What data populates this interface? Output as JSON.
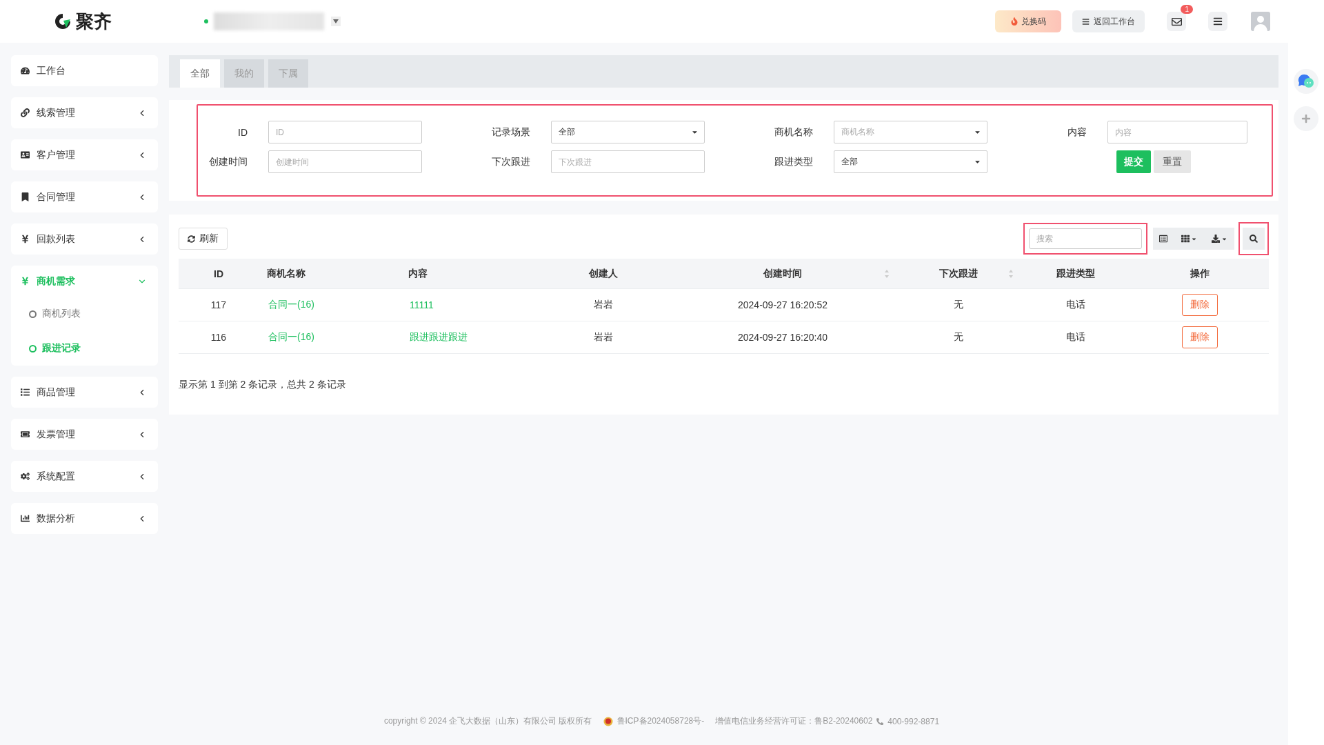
{
  "header": {
    "logo_text": "聚齐",
    "redeem_button": "兑换码",
    "back_button": "返回工作台",
    "mail_badge": "1"
  },
  "sidebar": {
    "items": [
      {
        "label": "工作台",
        "selected": false
      },
      {
        "label": "线索管理",
        "expanded": false,
        "selected": false
      },
      {
        "label": "客户管理",
        "expanded": false,
        "selected": false
      },
      {
        "label": "合同管理",
        "expanded": false,
        "selected": false
      },
      {
        "label": "回款列表",
        "expanded": false,
        "selected": false
      },
      {
        "label": "商机需求",
        "expanded": true,
        "selected": true,
        "children": [
          {
            "label": "商机列表",
            "selected": false
          },
          {
            "label": "跟进记录",
            "selected": true
          }
        ]
      },
      {
        "label": "商品管理",
        "expanded": false,
        "selected": false
      },
      {
        "label": "发票管理",
        "expanded": false,
        "selected": false
      },
      {
        "label": "系统配置",
        "expanded": false,
        "selected": false
      },
      {
        "label": "数据分析",
        "expanded": false,
        "selected": false
      }
    ]
  },
  "tabs": [
    {
      "label": "全部",
      "selected": true
    },
    {
      "label": "我的",
      "selected": false
    },
    {
      "label": "下属",
      "selected": false
    }
  ],
  "filters": {
    "fields": [
      {
        "kind": "input",
        "label": "ID",
        "placeholder": "ID"
      },
      {
        "kind": "select",
        "label": "记录场景",
        "value": "全部"
      },
      {
        "kind": "select",
        "label": "商机名称",
        "placeholder": "商机名称"
      },
      {
        "kind": "input",
        "label": "内容",
        "placeholder": "内容"
      },
      {
        "kind": "input",
        "label": "创建时间",
        "placeholder": "创建时间"
      },
      {
        "kind": "input",
        "label": "下次跟进",
        "placeholder": "下次跟进"
      },
      {
        "kind": "select",
        "label": "跟进类型",
        "value": "全部"
      }
    ],
    "submit_button": "提交",
    "reset_button": "重置"
  },
  "toolbar": {
    "refresh_button": "刷新",
    "search": {
      "placeholder": "搜索"
    }
  },
  "table": {
    "columns": [
      {
        "label": "ID",
        "sortable": false
      },
      {
        "label": "商机名称",
        "sortable": false
      },
      {
        "label": "内容",
        "sortable": false
      },
      {
        "label": "创建人",
        "sortable": false
      },
      {
        "label": "创建时间",
        "sortable": true
      },
      {
        "label": "下次跟进",
        "sortable": true
      },
      {
        "label": "跟进类型",
        "sortable": false
      },
      {
        "label": "操作",
        "sortable": false
      }
    ],
    "rows": [
      {
        "id": "117",
        "name": "合同一(16)",
        "content": "11111",
        "creator": "岩岩",
        "created": "2024-09-27 16:20:52",
        "next": "无",
        "type": "电话",
        "action": "删除"
      },
      {
        "id": "116",
        "name": "合同一(16)",
        "content": "跟进跟进跟进",
        "creator": "岩岩",
        "created": "2024-09-27 16:20:40",
        "next": "无",
        "type": "电话",
        "action": "删除"
      }
    ]
  },
  "pagination": "显示第 1 到第 2 条记录，总共 2 条记录",
  "footer": {
    "copyright": "copyright © 2024 企飞大数据（山东）有限公司 版权所有",
    "icp": "鲁ICP备2024058728号-",
    "license": "增值电信业务经营许可证：鲁B2-20240602",
    "phone": "400-992-8871"
  }
}
